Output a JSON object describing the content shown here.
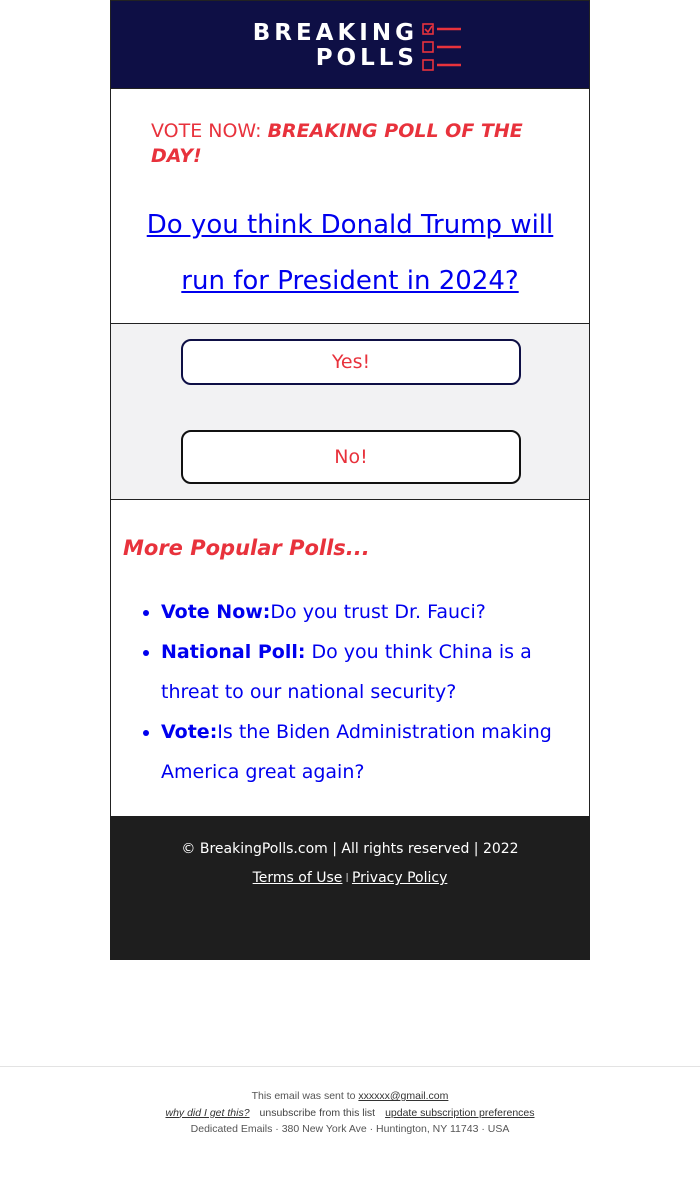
{
  "brand": {
    "line1": "BREAKING",
    "line2": "POLLS",
    "header_bg": "#0e0f45",
    "accent": "#e8323c"
  },
  "headline": {
    "prefix": "VOTE NOW: ",
    "emphasis": "BREAKING POLL OF THE DAY!"
  },
  "question": {
    "text": "Do you think Donald Trump will run for President in 2024?"
  },
  "vote": {
    "yes_label": "Yes!",
    "no_label": "No!"
  },
  "more": {
    "title": "More Popular Polls...",
    "items": [
      {
        "label": "Vote Now:",
        "text": "Do you trust Dr. Fauci?"
      },
      {
        "label": "National Poll:",
        "text": " Do you think China is a threat to our national security?"
      },
      {
        "label": "Vote:",
        "text": "Is the Biden Administration making America great again?"
      }
    ]
  },
  "footer": {
    "copyright": "© BreakingPolls.com | All rights reserved | 2022",
    "terms": "Terms of Use",
    "separator": "I",
    "privacy": "Privacy Policy"
  },
  "legal": {
    "sent_to_prefix": "This email was sent to ",
    "email": "xxxxxx@gmail.com",
    "why": "why did I get this?",
    "unsubscribe": "unsubscribe from this list",
    "update": "update subscription preferences",
    "address": "Dedicated Emails · 380 New York Ave · Huntington, NY 11743 · USA"
  }
}
